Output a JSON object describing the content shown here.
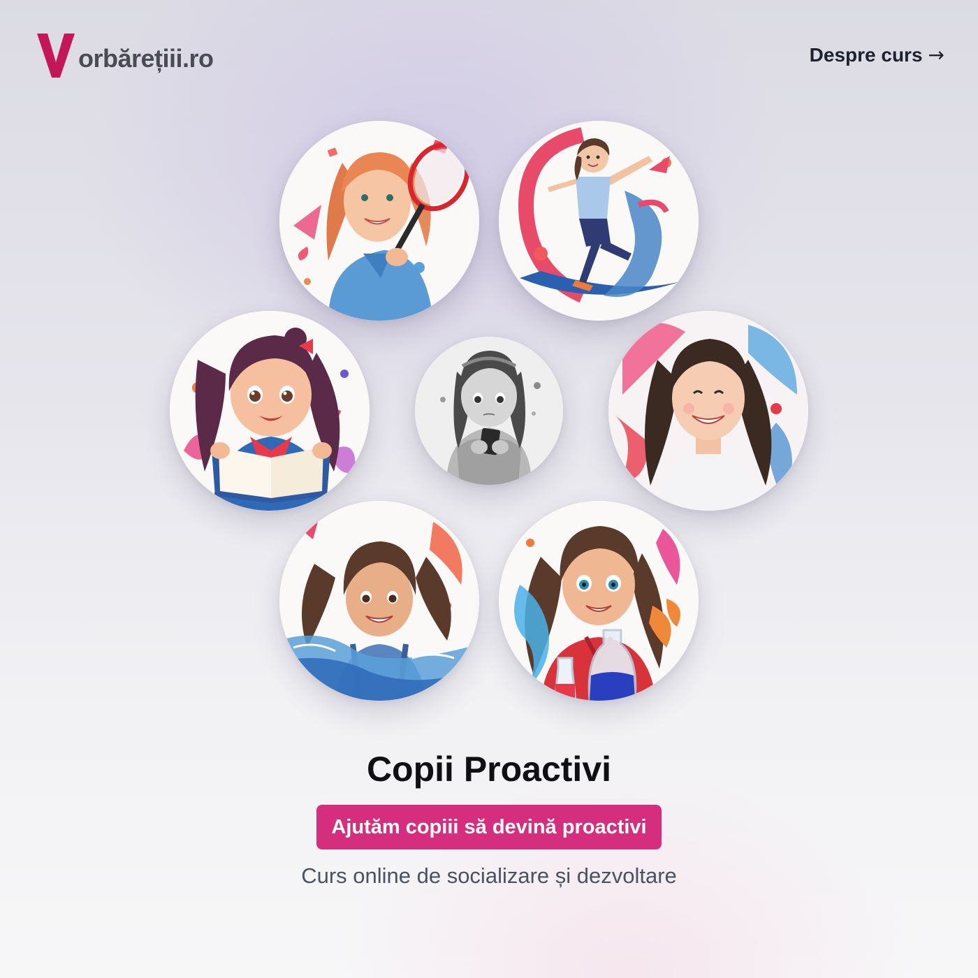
{
  "header": {
    "logo_letter": "V",
    "logo_text": "orbărețiii.ro",
    "nav_link_label": "Despre curs",
    "nav_link_arrow": "→"
  },
  "colors": {
    "brand": "#c2185b",
    "cta_background": "#d62e7e",
    "title_text": "#0f0f14",
    "subtitle_text": "#4a5163"
  },
  "illustrations": [
    {
      "name": "girl-with-tennis-racket",
      "style": "color"
    },
    {
      "name": "girl-dancing",
      "style": "color"
    },
    {
      "name": "girl-reading-book",
      "style": "color"
    },
    {
      "name": "girl-with-phone",
      "style": "grayscale"
    },
    {
      "name": "girl-smiling-paint-splash",
      "style": "color"
    },
    {
      "name": "girl-swimming",
      "style": "color"
    },
    {
      "name": "girl-science-experiment",
      "style": "color"
    }
  ],
  "hero": {
    "title": "Copii Proactivi",
    "cta_label": "Ajutăm copiii să devină proactivi",
    "subtitle": "Curs online de socializare și dezvoltare"
  }
}
